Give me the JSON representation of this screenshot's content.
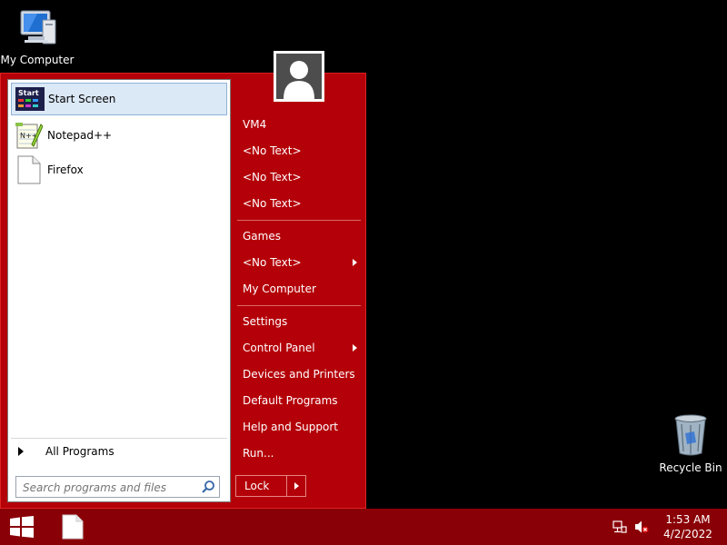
{
  "desktop": {
    "my_computer_label": "My Computer",
    "recycle_bin_label": "Recycle Bin"
  },
  "start_menu": {
    "programs": [
      {
        "label": "Start Screen",
        "icon": "start-screen-icon",
        "icon_text": "Start",
        "selected": true
      },
      {
        "label": "Notepad++",
        "icon": "notepad-plus-plus-icon",
        "icon_text": "N++"
      },
      {
        "label": "Firefox",
        "icon": "blank-document-icon"
      }
    ],
    "all_programs_label": "All Programs",
    "search_placeholder": "Search programs and files",
    "right_items": [
      {
        "label": "VM4"
      },
      {
        "label": "<No Text>"
      },
      {
        "label": "<No Text>"
      },
      {
        "label": "<No Text>"
      },
      {
        "label": "Games"
      },
      {
        "label": "<No Text>",
        "submenu": true
      },
      {
        "label": "My Computer"
      },
      {
        "label": "Settings"
      },
      {
        "label": "Control Panel",
        "submenu": true
      },
      {
        "label": "Devices and Printers"
      },
      {
        "label": "Default Programs"
      },
      {
        "label": "Help and Support"
      },
      {
        "label": "Run..."
      }
    ],
    "lock_label": "Lock"
  },
  "taskbar": {
    "time": "1:53 AM",
    "date": "4/2/2022"
  },
  "colors": {
    "menu_bg": "#b40008",
    "taskbar_bg": "#8a0007",
    "selected_bg": "#dbe8f6"
  }
}
